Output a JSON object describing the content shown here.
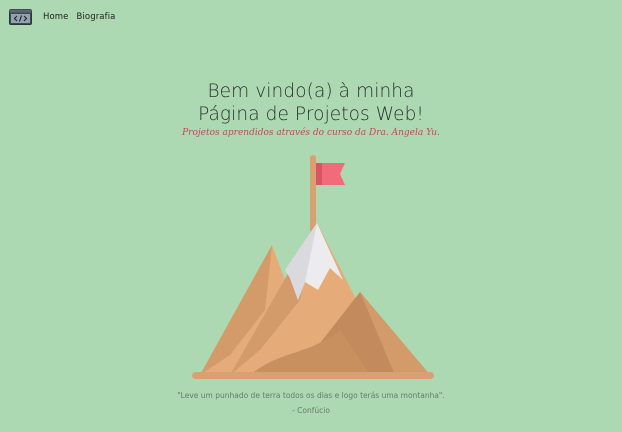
{
  "nav": {
    "logo_icon": "code-editor-icon",
    "items": [
      {
        "label": "Home"
      },
      {
        "label": "Biografia"
      }
    ]
  },
  "hero": {
    "title_line1": "Bem vindo(a) à minha",
    "title_line2": "Página de Projetos Web!",
    "subtitle": "Projetos aprendidos através do curso da Dra. Angela Yu."
  },
  "illustration": {
    "icon": "mountain-flag-icon"
  },
  "quote": {
    "text": "\"Leve um punhado de terra todos os dias e logo terás uma montanha\".",
    "author": "- Confúcio"
  },
  "colors": {
    "background": "#acd8b2",
    "flag": "#f16b7b",
    "mountain_light": "#e5ac79",
    "mountain_mid": "#d39a6a",
    "mountain_dark": "#c38a5e",
    "snow": "#ececef",
    "pole": "#d9a172"
  }
}
